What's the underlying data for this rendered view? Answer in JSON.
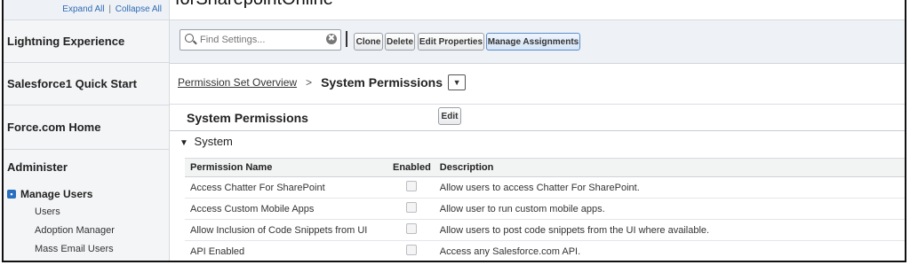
{
  "sidebar": {
    "expand_all": "Expand All",
    "separator": "|",
    "collapse_all": "Collapse All",
    "sections": [
      "Lightning Experience",
      "Salesforce1 Quick Start",
      "Force.com Home"
    ],
    "administer": "Administer",
    "group_toggle": "▪",
    "group_label": "Manage Users",
    "sub_items": [
      "Users",
      "Adoption Manager",
      "Mass Email Users"
    ]
  },
  "header": {
    "title_partial": "forSharepointOnline"
  },
  "toolbar": {
    "search_placeholder": "Find Settings...",
    "clear_symbol": "✖",
    "buttons": [
      "Clone",
      "Delete",
      "Edit Properties",
      "Manage Assignments"
    ]
  },
  "breadcrumb": {
    "link": "Permission Set Overview",
    "separator": ">",
    "current": "System Permissions",
    "dropdown_symbol": "▼"
  },
  "panel": {
    "title": "System Permissions",
    "edit_label": "Edit",
    "section_arrow": "▼",
    "section_title": "System"
  },
  "table": {
    "headers": [
      "Permission Name",
      "Enabled",
      "Description"
    ],
    "rows": [
      {
        "name": "Access Chatter For SharePoint",
        "enabled": false,
        "description": "Allow users to access Chatter For SharePoint."
      },
      {
        "name": "Access Custom Mobile Apps",
        "enabled": false,
        "description": "Allow user to run custom mobile apps."
      },
      {
        "name": "Allow Inclusion of Code Snippets from UI",
        "enabled": false,
        "description": "Allow users to post code snippets from the UI where available."
      },
      {
        "name": "API Enabled",
        "enabled": false,
        "description": "Access any Salesforce.com API."
      }
    ]
  },
  "colors": {
    "link": "#2f6cb5",
    "sidebar_bg": "#f4f5f7",
    "toolbar_bg": "#eef1f5",
    "toggle": "#2a6fbf"
  },
  "icons": {
    "search": "search-icon",
    "clear": "clear-icon",
    "dropdown": "chevron-down-icon",
    "toggle": "collapse-toggle-icon"
  }
}
